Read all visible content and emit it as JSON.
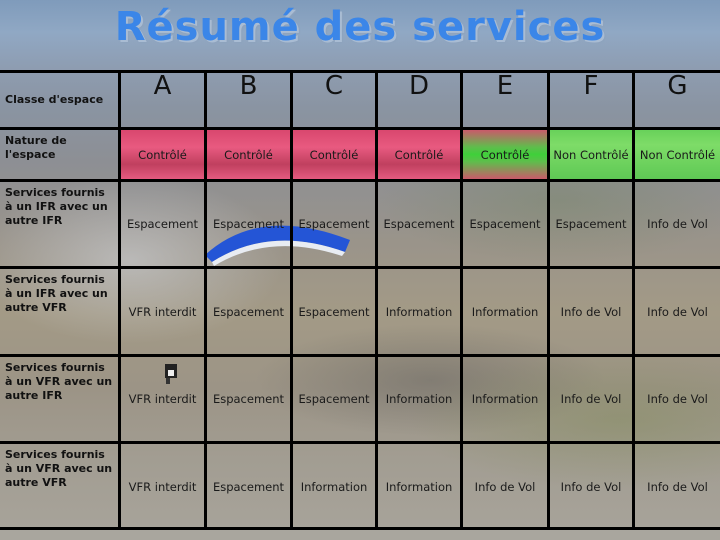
{
  "title": "Résumé des services",
  "table": {
    "row_headers": [
      "Classe d'espace",
      "Nature de l'espace",
      "Services fournis à un IFR avec un autre IFR",
      "Services fournis à un IFR avec un autre VFR",
      "Services fournis à un VFR avec un autre IFR",
      "Services fournis à un VFR avec un autre VFR"
    ],
    "classes": [
      "A",
      "B",
      "C",
      "D",
      "E",
      "F",
      "G"
    ],
    "nature": [
      "Contrôlé",
      "Contrôlé",
      "Contrôlé",
      "Contrôlé",
      "Contrôlé",
      "Non Contrôlé",
      "Non Contrôlé"
    ],
    "nature_status": [
      "controlled",
      "controlled",
      "controlled",
      "controlled",
      "mixed",
      "uncontrolled",
      "uncontrolled"
    ],
    "services": [
      [
        "Espacement",
        "Espacement",
        "Espacement",
        "Espacement",
        "Espacement",
        "Espacement",
        "Info de Vol"
      ],
      [
        "VFR interdit",
        "Espacement",
        "Espacement",
        "Information",
        "Information",
        "Info de Vol",
        "Info de Vol"
      ],
      [
        "VFR interdit",
        "Espacement",
        "Espacement",
        "Information",
        "Information",
        "Info de Vol",
        "Info de Vol"
      ],
      [
        "VFR interdit",
        "Espacement",
        "Information",
        "Information",
        "Info de Vol",
        "Info de Vol",
        "Info de Vol"
      ]
    ]
  },
  "colors": {
    "title": "#3b86e8",
    "controlled": "#e05578",
    "uncontrolled": "#6fd45e"
  },
  "decorations": [
    "paraglider-wing-icon",
    "pilot-icon"
  ]
}
